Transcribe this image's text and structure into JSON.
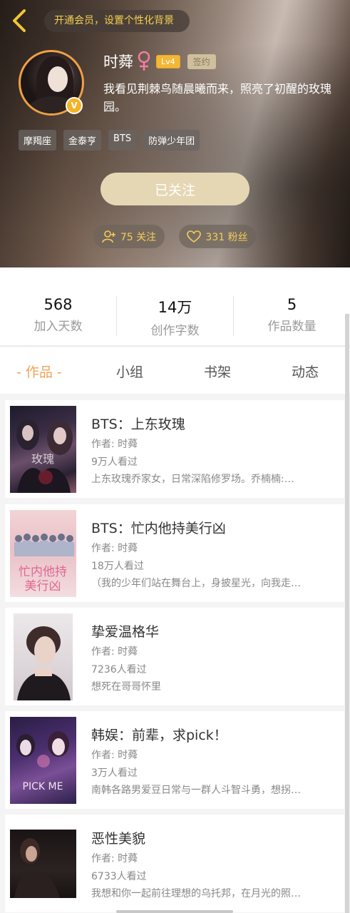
{
  "header": {
    "vip_banner": "开通会员，设置个性化背景",
    "user_name": "时蕣",
    "level": "Lv4",
    "sign_badge": "签约",
    "bio": "我看见荆棘鸟随晨曦而来，照亮了初醒的玫瑰园。",
    "tags": [
      "摩羯座",
      "金泰亨",
      "BTS",
      "防弹少年团"
    ],
    "follow_button": "已关注",
    "following_count": "75 关注",
    "fans_count": "331 粉丝"
  },
  "stats": [
    {
      "value": "568",
      "label": "加入天数"
    },
    {
      "value": "14万",
      "label": "创作字数"
    },
    {
      "value": "5",
      "label": "作品数量"
    }
  ],
  "tabs": [
    "- 作品 -",
    "小组",
    "书架",
    "动态"
  ],
  "works": [
    {
      "title": "BTS：上东玫瑰",
      "author": "作者: 时蕣",
      "views": "9万人看过",
      "desc": "上东玫瑰乔家女，日常深陷修罗场。乔楠楠:…"
    },
    {
      "title": "BTS：忙内他持美行凶",
      "author": "作者: 时蕣",
      "views": "18万人看过",
      "desc": "（我的少年们站在舞台上，身披星光，向我走…"
    },
    {
      "title": "挚爱温格华",
      "author": "作者: 时蕣",
      "views": "7236人看过",
      "desc": "想死在哥哥怀里"
    },
    {
      "title": "韩娱：前辈，求pick！",
      "author": "作者: 时蕣",
      "views": "3万人看过",
      "desc": "南韩各路男爱豆日常与一群人斗智斗勇，想拐…"
    },
    {
      "title": "恶性美貌",
      "author": "作者: 时蕣",
      "views": "6733人看过",
      "desc": "我想和你一起前往理想的乌托邦，在月光的照…"
    }
  ],
  "colors": {
    "accent": "#f0a35a",
    "gold_text": "#f4cf4f",
    "follow_button": "#e5d7b4"
  }
}
